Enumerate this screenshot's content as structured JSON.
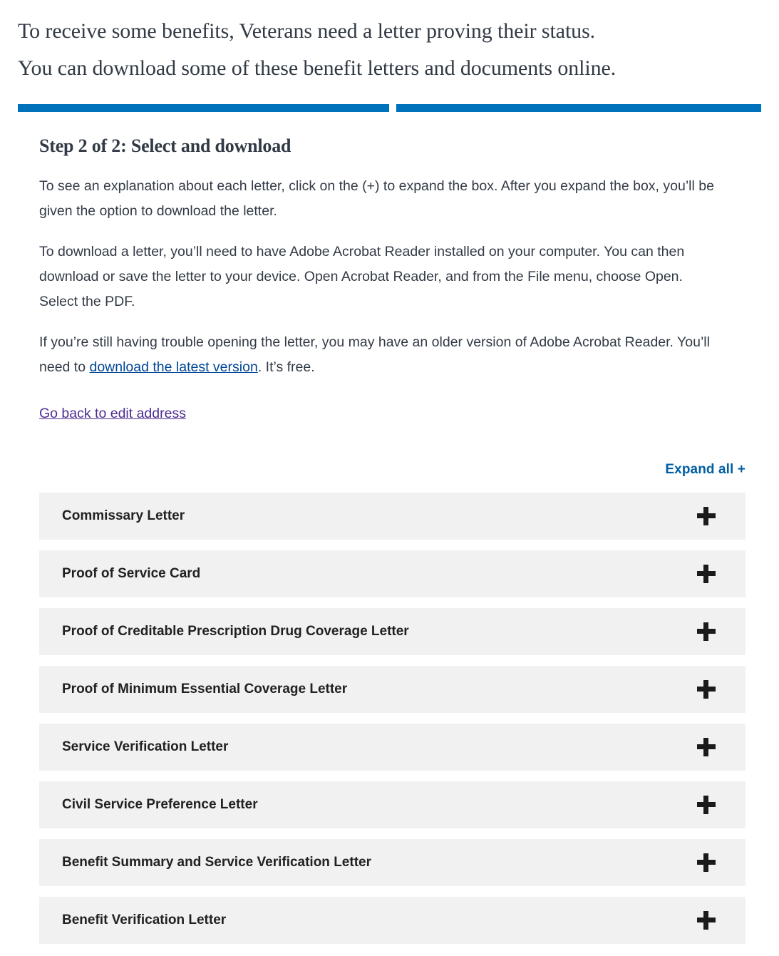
{
  "intro": {
    "line1": "To receive some benefits, Veterans need a letter proving their status.",
    "line2": "You can download some of these benefit letters and documents online."
  },
  "progress": {
    "steps_total": 2,
    "steps_complete": 2,
    "color": "#0071bb"
  },
  "step": {
    "title": "Step 2 of 2: Select and download",
    "paragraph_1": "To see an explanation about each letter, click on the (+) to expand the box. After you expand the box, you’ll be given the option to download the letter.",
    "paragraph_2": "To download a letter, you’ll need to have Adobe Acrobat Reader installed on your computer. You can then download or save the letter to your device. Open Acrobat Reader, and from the File menu, choose Open. Select the PDF.",
    "paragraph_3_before": "If you’re still having trouble opening the letter, you may have an older version of Adobe Acrobat Reader. You’ll need to ",
    "paragraph_3_link": "download the latest version",
    "paragraph_3_after": ". It’s free.",
    "back_link": "Go back to edit address"
  },
  "accordion": {
    "expand_all_label": "Expand all +",
    "expand_all_color": "#005ea2",
    "row_background": "#f1f1f1",
    "toggle_icon": "plus-icon",
    "items": [
      {
        "label": "Commissary Letter"
      },
      {
        "label": "Proof of Service Card"
      },
      {
        "label": "Proof of Creditable Prescription Drug Coverage Letter"
      },
      {
        "label": "Proof of Minimum Essential Coverage Letter"
      },
      {
        "label": "Service Verification Letter"
      },
      {
        "label": "Civil Service Preference Letter"
      },
      {
        "label": "Benefit Summary and Service Verification Letter"
      },
      {
        "label": "Benefit Verification Letter"
      }
    ]
  }
}
